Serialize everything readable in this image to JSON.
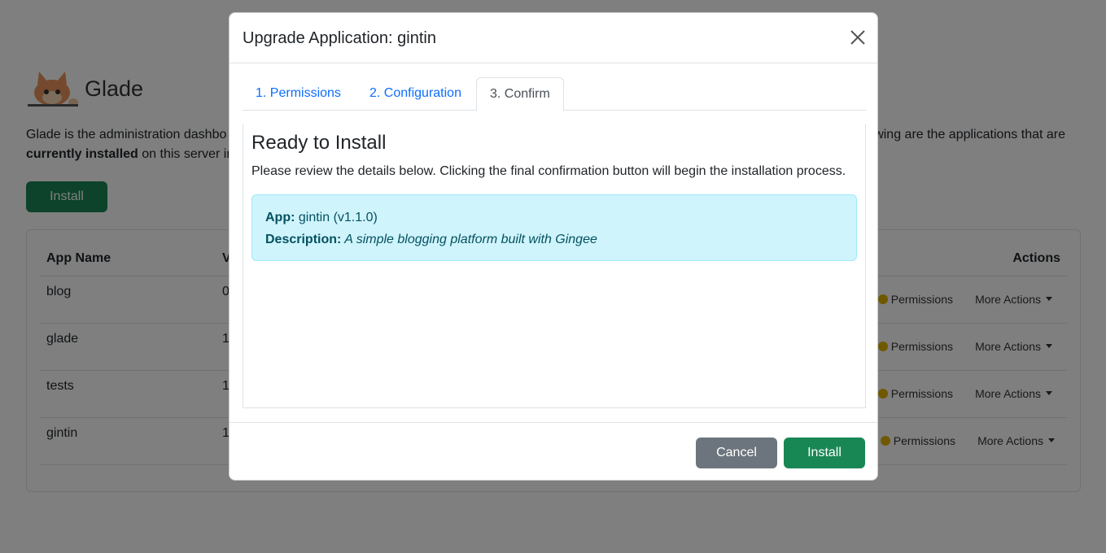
{
  "background": {
    "brand": {
      "title": "Glade",
      "logo_icon": "cat-logo-icon"
    },
    "intro": {
      "line1_start": "Glade is the administration dashbo",
      "line1_end": "wing are the applications that are",
      "line2_bold": "currently installed",
      "line2_rest": " on this server ins"
    },
    "install_button": "Install",
    "table": {
      "headers": {
        "app_name": "App Name",
        "version": "V",
        "actions": "Actions"
      },
      "rows": [
        {
          "name": "blog",
          "version": "0",
          "permissions": "Permissions",
          "more_actions": "More Actions"
        },
        {
          "name": "glade",
          "version": "1",
          "permissions": "Permissions",
          "more_actions": "More Actions"
        },
        {
          "name": "tests",
          "version": "1",
          "permissions": "Permissions",
          "more_actions": "More Actions"
        },
        {
          "name": "gintin",
          "version": "1",
          "permissions": "Permissions",
          "more_actions": "More Actions"
        }
      ]
    }
  },
  "modal": {
    "title": "Upgrade Application: gintin",
    "close_icon": "close-icon",
    "tabs": [
      {
        "label": "1. Permissions",
        "active": false
      },
      {
        "label": "2. Configuration",
        "active": false
      },
      {
        "label": "3. Confirm",
        "active": true
      }
    ],
    "confirm": {
      "heading": "Ready to Install",
      "description": "Please review the details below. Clicking the final confirmation button will begin the installation process.",
      "app_label": "App:",
      "app_value": " gintin (v1.1.0)",
      "description_label": "Description:",
      "description_value": " A simple blogging platform built with Gingee"
    },
    "footer": {
      "cancel": "Cancel",
      "install": "Install"
    }
  },
  "colors": {
    "primary": "#0d6efd",
    "success": "#198754",
    "secondary": "#6c757d",
    "info_bg": "#cff4fc",
    "info_text": "#055160"
  }
}
